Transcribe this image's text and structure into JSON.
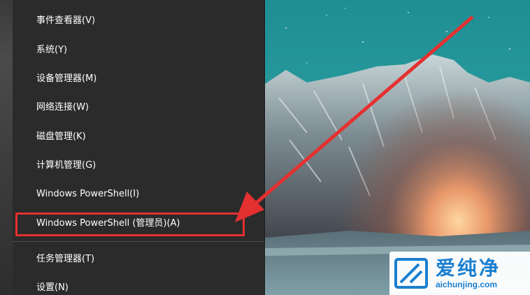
{
  "context_menu": {
    "items": [
      {
        "label": "事件查看器(V)"
      },
      {
        "label": "系统(Y)"
      },
      {
        "label": "设备管理器(M)"
      },
      {
        "label": "网络连接(W)"
      },
      {
        "label": "磁盘管理(K)"
      },
      {
        "label": "计算机管理(G)"
      },
      {
        "label": "Windows PowerShell(I)"
      },
      {
        "label": "Windows PowerShell (管理员)(A)",
        "highlighted": true
      },
      {
        "label": "任务管理器(T)"
      },
      {
        "label": "设置(N)"
      }
    ]
  },
  "annotation": {
    "highlight_color": "#e53030",
    "arrow_color": "#e53030"
  },
  "watermark": {
    "title": "爱纯净",
    "url": "aichunjing.com",
    "color": "#1b7fd0"
  },
  "colors": {
    "menu_background": "#2b2b2b",
    "menu_text": "#ffffff"
  }
}
